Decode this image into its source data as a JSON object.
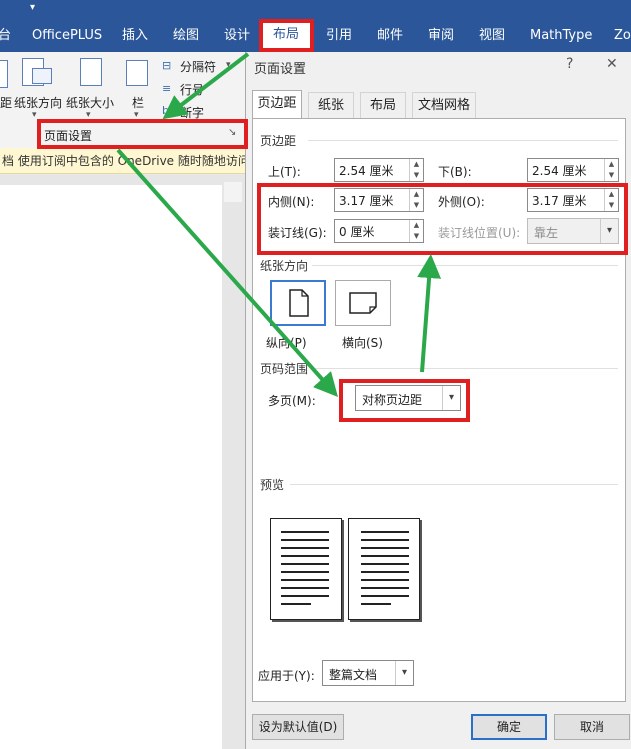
{
  "ribbon": {
    "tabs": [
      "台",
      "OfficePLUS",
      "插入",
      "绘图",
      "设计",
      "布局",
      "引用",
      "邮件",
      "审阅",
      "视图",
      "MathType",
      "Zo"
    ],
    "active_tab": "布局",
    "buttons": {
      "margins_fragment": "距",
      "orientation": "纸张方向",
      "size": "纸张大小",
      "columns": "栏",
      "breaks": "分隔符",
      "line_numbers": "行号",
      "hyphenation": "断字",
      "group_label": "页面设置"
    },
    "notice": "档  使用订阅中包含的 OneDrive 随时随地访问"
  },
  "dialog": {
    "title": "页面设置",
    "help": "?",
    "close": "✕",
    "tabs": [
      "页边距",
      "纸张",
      "布局",
      "文档网格"
    ],
    "margins_section": "页边距",
    "fields": {
      "top_label": "上(T):",
      "top_value": "2.54 厘米",
      "bottom_label": "下(B):",
      "bottom_value": "2.54 厘米",
      "inside_label": "内侧(N):",
      "inside_value": "3.17 厘米",
      "outside_label": "外侧(O):",
      "outside_value": "3.17 厘米",
      "gutter_label": "装订线(G):",
      "gutter_value": "0 厘米",
      "gutter_pos_label": "装订线位置(U):",
      "gutter_pos_value": "靠左"
    },
    "orientation_section": "纸张方向",
    "portrait_label": "纵向(P)",
    "landscape_label": "横向(S)",
    "pages_section": "页码范围",
    "multiple_pages_label": "多页(M):",
    "multiple_pages_value": "对称页边距",
    "preview_section": "预览",
    "apply_to_label": "应用于(Y):",
    "apply_to_value": "整篇文档",
    "default_button": "设为默认值(D)",
    "ok_button": "确定",
    "cancel_button": "取消"
  },
  "colors": {
    "ribbon_blue": "#2b579a",
    "highlight_red": "#e02020",
    "arrow_green": "#2aa84a",
    "selected_blue": "#3a7ad0"
  }
}
